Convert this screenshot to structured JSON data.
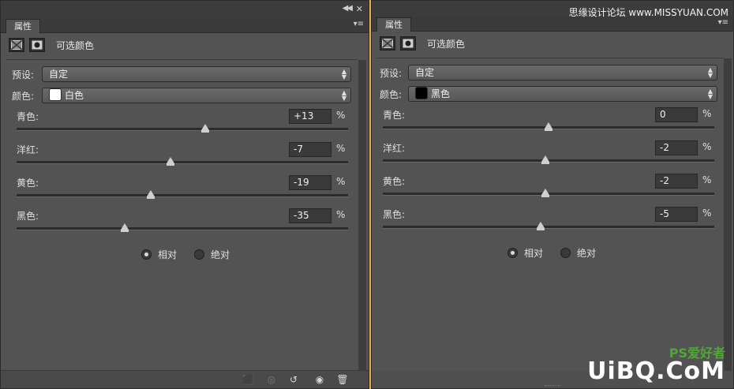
{
  "panel_left": {
    "tab_label": "属性",
    "title": "可选颜色",
    "preset_label": "预设:",
    "preset_value": "自定",
    "color_label": "颜色:",
    "color_value": "白色",
    "color_swatch": "#ffffff",
    "sliders": [
      {
        "label": "青色:",
        "value": "+13",
        "unit": "%",
        "fraction": 0.57
      },
      {
        "label": "洋红:",
        "value": "-7",
        "unit": "%",
        "fraction": 0.465
      },
      {
        "label": "黄色:",
        "value": "-19",
        "unit": "%",
        "fraction": 0.405
      },
      {
        "label": "黑色:",
        "value": "-35",
        "unit": "%",
        "fraction": 0.325
      }
    ],
    "method_relative": "相对",
    "method_absolute": "绝对",
    "method_selected": "relative"
  },
  "panel_right": {
    "tab_label": "属性",
    "title": "可选颜色",
    "preset_label": "预设:",
    "preset_value": "自定",
    "color_label": "颜色:",
    "color_value": "黑色",
    "color_swatch": "#000000",
    "sliders": [
      {
        "label": "青色:",
        "value": "0",
        "unit": "%",
        "fraction": 0.5
      },
      {
        "label": "洋红:",
        "value": "-2",
        "unit": "%",
        "fraction": 0.49
      },
      {
        "label": "黄色:",
        "value": "-2",
        "unit": "%",
        "fraction": 0.49
      },
      {
        "label": "黑色:",
        "value": "-5",
        "unit": "%",
        "fraction": 0.475
      }
    ],
    "method_relative": "相对",
    "method_absolute": "绝对",
    "method_selected": "relative"
  },
  "watermark_top": "思缘设计论坛 www.MISSYUAN.COM",
  "watermark_bottom": "UiBQ.CoM",
  "watermark_logo": "PS爱好者",
  "colors": {
    "panel_bg": "#535353",
    "accent_border": "#e8b14a"
  }
}
